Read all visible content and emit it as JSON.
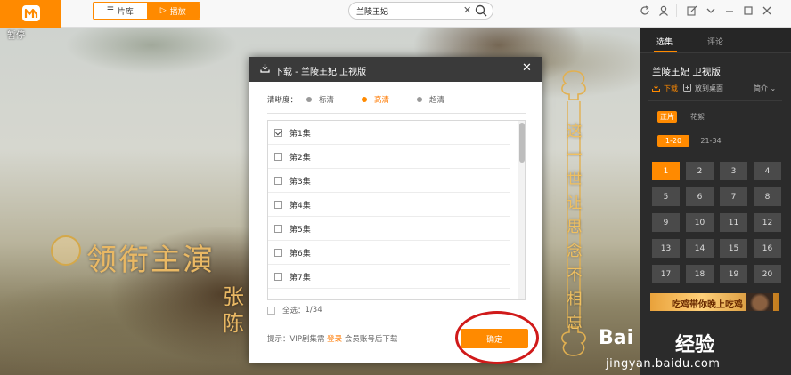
{
  "app": {
    "brand_color": "#ff8a00"
  },
  "nav": {
    "tab_library": "片库",
    "tab_play": "播放",
    "active_tab": "play"
  },
  "search": {
    "value": "兰陵王妃",
    "clear_icon": "close-icon",
    "search_icon": "search-icon"
  },
  "window_controls": [
    "refresh-icon",
    "user-icon",
    "edit-icon",
    "chevron-down-icon",
    "minimize-icon",
    "maximize-icon",
    "close-icon"
  ],
  "video": {
    "pause_label": "暂停",
    "overlay_lead": "领衔主演",
    "overlay_actor": "张陈",
    "overlay_lyric": "这一世让思念不相忘"
  },
  "dialog": {
    "title": "下载 - 兰陵王妃 卫视版",
    "quality_label": "清晰度：",
    "quality_options": [
      {
        "label": "标清",
        "selected": false
      },
      {
        "label": "高清",
        "selected": true
      },
      {
        "label": "超清",
        "selected": false
      }
    ],
    "episodes": [
      {
        "label": "第1集",
        "checked": true
      },
      {
        "label": "第2集",
        "checked": false
      },
      {
        "label": "第3集",
        "checked": false
      },
      {
        "label": "第4集",
        "checked": false
      },
      {
        "label": "第5集",
        "checked": false
      },
      {
        "label": "第6集",
        "checked": false
      },
      {
        "label": "第7集",
        "checked": false
      }
    ],
    "select_all_label": "全选：",
    "select_count": "1/34",
    "tip_prefix": "提示：VIP剧集需",
    "tip_link": "登录",
    "tip_suffix": "会员账号后下载",
    "confirm_label": "确定"
  },
  "panel": {
    "tab_episodes": "选集",
    "tab_comments": "评论",
    "show_title": "兰陵王妃 卫视版",
    "download_label": "下载",
    "desktop_label": "放到桌面",
    "intro_label": "简介",
    "content_tabs": [
      {
        "label": "正片",
        "active": true
      },
      {
        "label": "花絮",
        "active": false
      }
    ],
    "range_tabs": [
      {
        "label": "1-20",
        "active": true
      },
      {
        "label": "21-34",
        "active": false
      }
    ],
    "episode_numbers": [
      "1",
      "2",
      "3",
      "4",
      "5",
      "6",
      "7",
      "8",
      "9",
      "10",
      "11",
      "12",
      "13",
      "14",
      "15",
      "16",
      "17",
      "18",
      "19",
      "20"
    ],
    "selected_episode": "1",
    "banner_text": "吃鸡带你晚上吃鸡"
  },
  "watermark": {
    "brand": "Bai",
    "brand2": "经验",
    "url": "jingyan.baidu.com"
  }
}
